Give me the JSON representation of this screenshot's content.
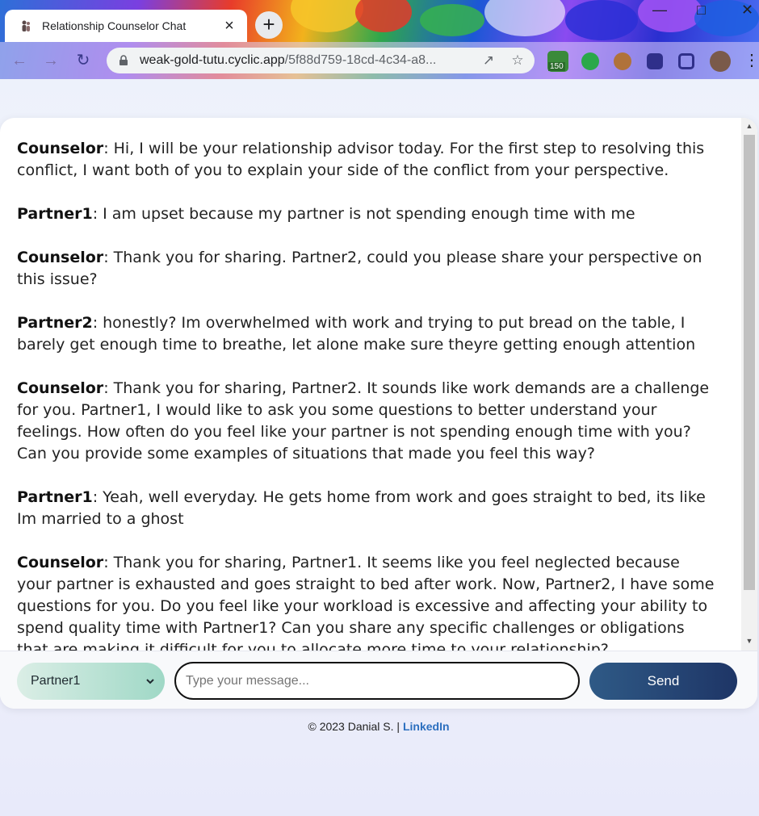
{
  "browser": {
    "tab_title": "Relationship Counselor Chat",
    "tab_close": "×",
    "new_tab": "+",
    "url_host": "weak-gold-tutu.cyclic.app",
    "url_path": "/5f88d759-18cd-4c34-a8...",
    "extension_badge": "150"
  },
  "chat": {
    "messages": [
      {
        "sender": "Counselor",
        "text": ": Hi, I will be your relationship advisor today. For the first step to resolving this conflict, I want both of you to explain your side of the conflict from your perspective."
      },
      {
        "sender": "Partner1",
        "text": ": I am upset because my partner is not spending enough time with me"
      },
      {
        "sender": "Counselor",
        "text": ": Thank you for sharing. Partner2, could you please share your perspective on this issue?"
      },
      {
        "sender": "Partner2",
        "text": ": honestly? Im overwhelmed with work and trying to put bread on the table, I barely get enough time to breathe, let alone make sure theyre getting enough attention"
      },
      {
        "sender": "Counselor",
        "text": ": Thank you for sharing, Partner2. It sounds like work demands are a challenge for you. Partner1, I would like to ask you some questions to better understand your feelings. How often do you feel like your partner is not spending enough time with you? Can you provide some examples of situations that made you feel this way?"
      },
      {
        "sender": "Partner1",
        "text": ": Yeah, well everyday. He gets home from work and goes straight to bed, its like Im married to a ghost"
      },
      {
        "sender": "Counselor",
        "text": ": Thank you for sharing, Partner1. It seems like you feel neglected because your partner is exhausted and goes straight to bed after work. Now, Partner2, I have some questions for you. Do you feel like your workload is excessive and affecting your ability to spend quality time with Partner1? Can you share any specific challenges or obligations that are making it difficult for you to allocate more time to your relationship?"
      }
    ]
  },
  "input": {
    "selected_partner": "Partner1",
    "placeholder": "Type your message...",
    "send_label": "Send"
  },
  "footer": {
    "copyright": "© 2023 Danial S. |",
    "link_label": "LinkedIn"
  },
  "colors": {
    "send_button": "#26467a",
    "selector_gradient_end": "#9fd8c6",
    "link": "#2c6fbf"
  }
}
